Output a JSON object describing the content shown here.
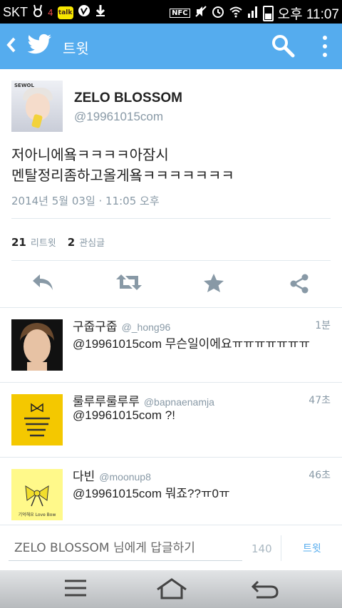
{
  "status_bar": {
    "carrier": "SKT",
    "notif_count": "4",
    "kakao_label": "talk",
    "nfc": "NFC",
    "time": "오후 11:07"
  },
  "action_bar": {
    "title": "트윗",
    "background": "#55acee"
  },
  "tweet": {
    "author_name": "ZELO BLOSSOM",
    "author_handle": "@19961015com",
    "avatar_tag": "SEWOL",
    "text_line1": "저아니에욬ㅋㅋㅋㅋ아잠시",
    "text_line2": "멘탈정리좀하고올게욬ㅋㅋㅋㅋㅋㅋㅋ",
    "timestamp": "2014년 5월 03일 · 11:05 오후",
    "retweets": "21",
    "retweets_label": "리트윗",
    "favorites": "2",
    "favorites_label": "관심글"
  },
  "actions": [
    "reply-icon",
    "retweet-icon",
    "favorite-icon",
    "share-icon"
  ],
  "replies": [
    {
      "name": "구줍구줍",
      "handle": "@_hong96",
      "time": "1분",
      "text": "@19961015com 무슨일이에요ㅠㅠㅠㅠㅠㅠㅠ"
    },
    {
      "name": "룰루루룰루루",
      "handle": "@bapnaenamja",
      "time": "47초",
      "text": "@19961015com ?!"
    },
    {
      "name": "다빈",
      "handle": "@moonup8",
      "time": "46초",
      "text": "@19961015com 뭐죠??ㅠ0ㅠ",
      "avatar_caption": "기억해요 Love Bow"
    }
  ],
  "compose": {
    "placeholder": "ZELO BLOSSOM 님에게 답글하기",
    "char_count": "140",
    "send_label": "트윗"
  }
}
